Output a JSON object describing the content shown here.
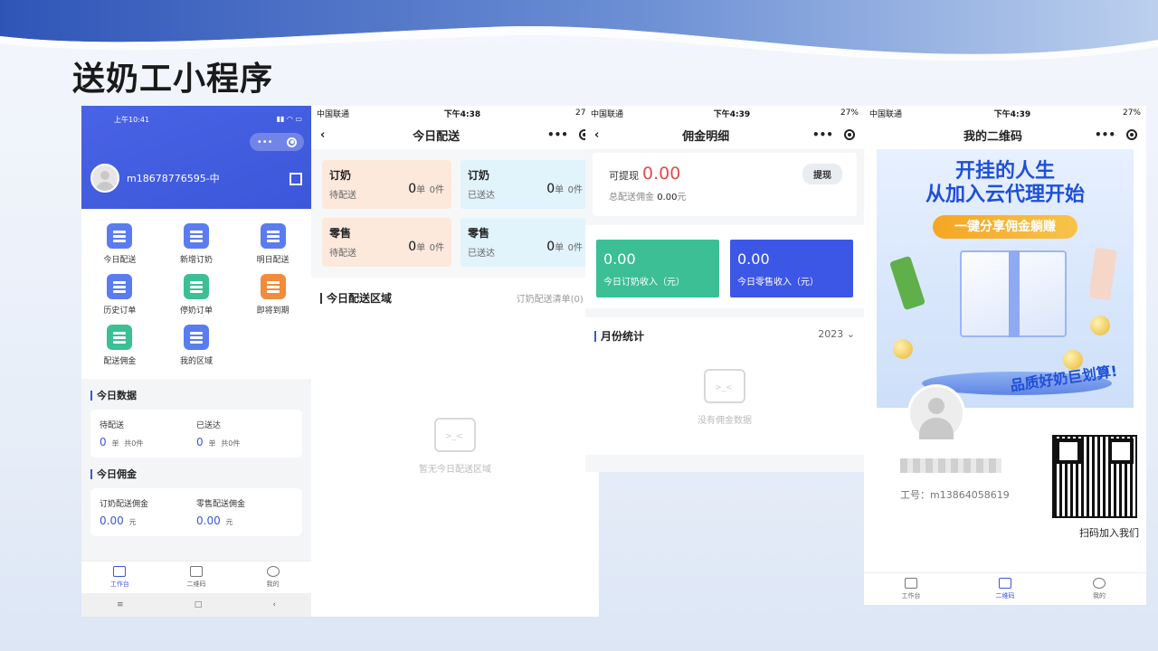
{
  "slide": {
    "title": "送奶工小程序"
  },
  "phone1": {
    "status_time": "上午10:41",
    "username": "m18678776595-中",
    "menu": [
      {
        "label": "今日配送",
        "color": "#5b7cf0"
      },
      {
        "label": "新增订奶",
        "color": "#5b7cf0"
      },
      {
        "label": "明日配送",
        "color": "#5b7cf0"
      },
      {
        "label": "历史订单",
        "color": "#5b7cf0"
      },
      {
        "label": "停奶订单",
        "color": "#3cbf94"
      },
      {
        "label": "即将到期",
        "color": "#f08c3c"
      },
      {
        "label": "配送佣金",
        "color": "#3cbf94"
      },
      {
        "label": "我的区域",
        "color": "#5b7cf0"
      }
    ],
    "today_data": {
      "title": "今日数据",
      "pending_label": "待配送",
      "pending_value": "0",
      "pending_unit": "单",
      "pending_total": "共0件",
      "delivered_label": "已送达",
      "delivered_value": "0",
      "delivered_unit": "单",
      "delivered_total": "共0件"
    },
    "today_commission": {
      "title": "今日佣金",
      "milk_label": "订奶配送佣金",
      "milk_value": "0.00",
      "milk_unit": "元",
      "retail_label": "零售配送佣金",
      "retail_value": "0.00",
      "retail_unit": "元"
    },
    "tabs": [
      "工作台",
      "二维码",
      "我的"
    ],
    "sysnav": [
      "≡",
      "□",
      "‹"
    ]
  },
  "phone2": {
    "carrier": "中国联通",
    "time": "下午4:38",
    "battery": "27%",
    "nav_title": "今日配送",
    "tiles": [
      {
        "t1": "订奶",
        "t2": "待配送",
        "count": "0",
        "unit": "单",
        "pieces": "0件"
      },
      {
        "t1": "订奶",
        "t2": "已送达",
        "count": "0",
        "unit": "单",
        "pieces": "0件"
      },
      {
        "t1": "零售",
        "t2": "待配送",
        "count": "0",
        "unit": "单",
        "pieces": "0件"
      },
      {
        "t1": "零售",
        "t2": "已送达",
        "count": "0",
        "unit": "单",
        "pieces": "0件"
      }
    ],
    "section_title": "今日配送区域",
    "section_link": "订奶配送清单(0) ›",
    "empty_text": "暂无今日配送区域"
  },
  "phone3": {
    "carrier": "中国联通",
    "time": "下午4:39",
    "battery": "27%",
    "nav_title": "佣金明细",
    "withdrawable_label": "可提现",
    "withdrawable_value": "0.00",
    "withdraw_button": "提现",
    "total_label": "总配送佣金",
    "total_value": "0.00",
    "total_unit": "元",
    "milk_income_value": "0.00",
    "milk_income_label": "今日订奶收入（元）",
    "retail_income_value": "0.00",
    "retail_income_label": "今日零售收入（元）",
    "monthly_title": "月份统计",
    "year": "2023 ⌄",
    "empty_text": "没有佣金数据"
  },
  "phone4": {
    "carrier": "中国联通",
    "time": "下午4:39",
    "battery": "27%",
    "nav_title": "我的二维码",
    "poster_line1": "开挂的人生",
    "poster_line2": "从加入云代理开始",
    "poster_pill": "一键分享佣金躺赚",
    "poster_slogan": "品质好奶巨划算!",
    "job_id": "工号：m13864058619",
    "qr_caption": "扫码加入我们",
    "tabs": [
      "工作台",
      "二维码",
      "我的"
    ]
  }
}
